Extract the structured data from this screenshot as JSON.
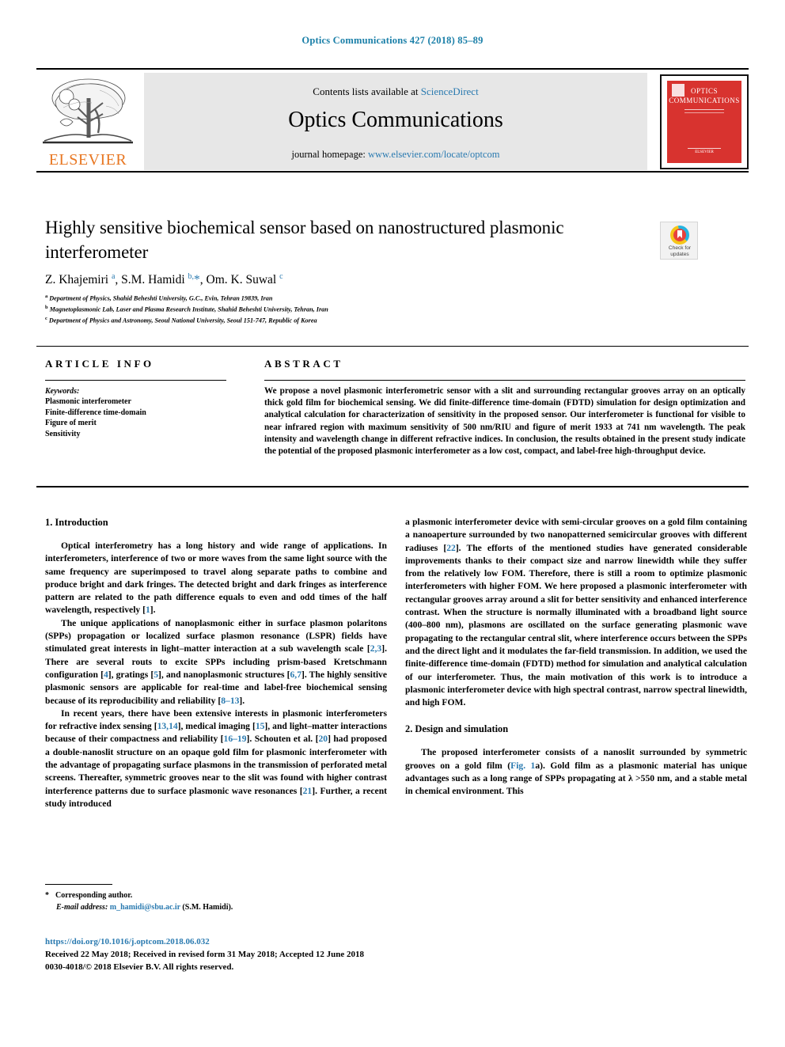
{
  "running_head": "Optics Communications 427 (2018) 85–89",
  "masthead": {
    "contents_prefix": "Contents lists available at ",
    "sciencedirect": "ScienceDirect",
    "journal_title": "Optics Communications",
    "homepage_prefix": "journal homepage: ",
    "homepage_url": "www.elsevier.com/locate/optcom",
    "publisher_wordmark": "ELSEVIER",
    "cover": {
      "line1": "OPTICS",
      "line2": "COMMUNICATIONS",
      "footer": "ELSEVIER"
    }
  },
  "article": {
    "title": "Highly sensitive biochemical sensor based on nanostructured plasmonic interferometer",
    "crossmark": {
      "line1": "Check for",
      "line2": "updates"
    },
    "authors_html": "Z. Khajemiri <sup>a</sup>, S.M. Hamidi <sup>b,</sup><span class=\"star\">*</span>, Om. K. Suwal <sup>c</sup>",
    "affiliations": [
      {
        "mark": "a",
        "text": "Department of Physics, Shahid Beheshti University, G.C., Evin, Tehran 19839, Iran"
      },
      {
        "mark": "b",
        "text": "Magnetoplasmonic Lab, Laser and Plasma Research Institute, Shahid Beheshti University, Tehran, Iran"
      },
      {
        "mark": "c",
        "text": "Department of Physics and Astronomy, Seoul National University, Seoul 151-747, Republic of Korea"
      }
    ]
  },
  "article_info": {
    "heading": "ARTICLE INFO",
    "keywords_label": "Keywords:",
    "keywords": [
      "Plasmonic interferometer",
      "Finite-difference time-domain",
      "Figure of merit",
      "Sensitivity"
    ]
  },
  "abstract": {
    "heading": "ABSTRACT",
    "text": "We propose a novel plasmonic interferometric sensor with a slit and surrounding rectangular grooves array on an optically thick gold film for biochemical sensing. We did finite-difference time-domain (FDTD) simulation for design optimization and analytical calculation for characterization of sensitivity in the proposed sensor. Our interferometer is functional for visible to near infrared region with maximum sensitivity of 500 nm/RIU and figure of merit 1933 at 741 nm wavelength. The peak intensity and wavelength change in different refractive indices. In conclusion, the results obtained in the present study indicate the potential of the proposed plasmonic interferometer as a low cost, compact, and label-free high-throughput device."
  },
  "body": {
    "left_column": {
      "section1_heading": "1. Introduction",
      "p1": "Optical interferometry has a long history and wide range of applications. In interferometers, interference of two or more waves from the same light source with the same frequency are superimposed to travel along separate paths to combine and produce bright and dark fringes. The detected bright and dark fringes as interference pattern are related to the path difference equals to even and odd times of the half wavelength, respectively [1].",
      "p2": "The unique applications of nanoplasmonic either in surface plasmon polaritons (SPPs) propagation or localized surface plasmon resonance (LSPR) fields have stimulated great interests in light–matter interaction at a sub wavelength scale [2,3]. There are several routs to excite SPPs including prism-based Kretschmann configuration [4], gratings [5], and nanoplasmonic structures [6,7]. The highly sensitive plasmonic sensors are applicable for real-time and label-free biochemical sensing because of its reproducibility and reliability [8–13].",
      "p3": "In recent years, there have been extensive interests in plasmonic interferometers for refractive index sensing [13,14], medical imaging [15], and light–matter interactions because of their compactness and reliability  [16–19]. Schouten et al. [20] had proposed a double-nanoslit structure on an opaque gold film for plasmonic interferometer with the advantage of propagating surface plasmons in the transmission of perforated metal screens. Thereafter, symmetric grooves near to the slit was found with higher contrast interference patterns due to surface plasmonic wave resonances [21]. Further, a recent study introduced"
    },
    "right_column": {
      "p1": "a plasmonic interferometer device with semi-circular grooves on a gold film containing a nanoaperture surrounded by two nanopatterned semicircular grooves with different radiuses [22]. The efforts of the mentioned studies have generated considerable improvements thanks to their compact size and narrow linewidth while they suffer from the relatively low FOM. Therefore, there is still a room to optimize plasmonic interferometers with higher FOM. We here proposed a plasmonic interferometer with rectangular grooves array around a slit for better sensitivity and enhanced interference contrast. When the structure is normally illuminated with a broadband light source (400–800 nm), plasmons are oscillated on the surface generating plasmonic wave propagating to the rectangular central slit, where interference occurs between the SPPs and the direct light and it modulates the far-field transmission. In addition, we used the finite-difference time-domain (FDTD) method for simulation and analytical calculation of our interferometer. Thus, the main motivation of this work is to introduce a plasmonic interferometer device with high spectral contrast, narrow spectral linewidth, and high FOM.",
      "section2_heading": "2. Design and simulation",
      "p2": "The proposed interferometer consists of a nanoslit surrounded by symmetric grooves on a gold film (Fig. 1a). Gold film as a plasmonic material has unique advantages such as a long range of SPPs propagating at λ >550 nm, and a stable metal in chemical environment. This"
    }
  },
  "footnotes": {
    "star": "*",
    "corresponding": "Corresponding author.",
    "email_label": "E-mail address:",
    "email": "m_hamidi@sbu.ac.ir",
    "email_suffix": "(S.M. Hamidi)."
  },
  "footer": {
    "doi": "https://doi.org/10.1016/j.optcom.2018.06.032",
    "dates": "Received 22 May 2018; Received in revised form 31 May 2018; Accepted 12 June 2018",
    "copyright": "0030-4018/© 2018 Elsevier B.V. All rights reserved."
  },
  "colors": {
    "link": "#2a7ab0",
    "elsevier_orange": "#E87722",
    "cover_red": "#d8332f"
  }
}
